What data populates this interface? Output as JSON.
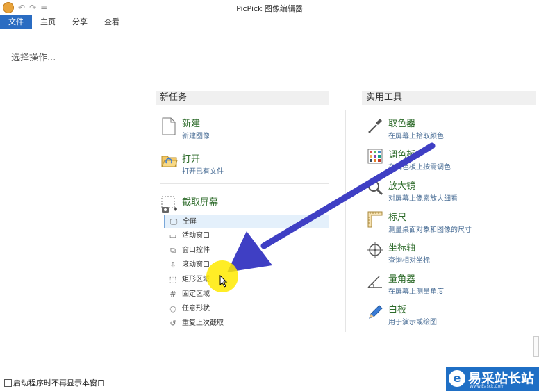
{
  "window": {
    "title": "PicPick 图像编辑器",
    "qat_more": "="
  },
  "tabs": [
    {
      "label": "文件",
      "active": true
    },
    {
      "label": "主页"
    },
    {
      "label": "分享"
    },
    {
      "label": "查看"
    }
  ],
  "prompt": "选择操作...",
  "new_task": {
    "header": "新任务",
    "items": [
      {
        "title": "新建",
        "subtitle": "新建图像",
        "icon": "blank-page-icon"
      },
      {
        "title": "打开",
        "subtitle": "打开已有文件",
        "icon": "open-folder-icon"
      },
      {
        "title": "截取屏幕",
        "subtitle": "",
        "icon": "screen-capture-icon"
      }
    ],
    "capture_options": [
      {
        "label": "全屏",
        "icon": "monitor-icon",
        "selected": true
      },
      {
        "label": "活动窗口",
        "icon": "window-icon"
      },
      {
        "label": "窗口控件",
        "icon": "window-control-icon"
      },
      {
        "label": "滚动窗口",
        "icon": "scroll-window-icon"
      },
      {
        "label": "矩形区域",
        "icon": "rectangle-select-icon"
      },
      {
        "label": "固定区域",
        "icon": "fixed-region-icon"
      },
      {
        "label": "任意形状",
        "icon": "freehand-icon"
      },
      {
        "label": "重复上次截取",
        "icon": "repeat-icon"
      }
    ]
  },
  "tools": {
    "header": "实用工具",
    "items": [
      {
        "title": "取色器",
        "subtitle": "在屏幕上拾取颜色",
        "icon": "eyedropper-icon"
      },
      {
        "title": "调色板",
        "subtitle": "在调色板上按需调色",
        "icon": "palette-icon"
      },
      {
        "title": "放大镜",
        "subtitle": "对屏幕上像素放大细看",
        "icon": "magnifier-icon"
      },
      {
        "title": "标尺",
        "subtitle": "测量桌面对象和图像的尺寸",
        "icon": "ruler-icon"
      },
      {
        "title": "坐标轴",
        "subtitle": "查询相对坐标",
        "icon": "crosshair-icon"
      },
      {
        "title": "量角器",
        "subtitle": "在屏幕上测量角度",
        "icon": "protractor-icon"
      },
      {
        "title": "白板",
        "subtitle": "用于演示或绘图",
        "icon": "pen-icon"
      }
    ]
  },
  "footer": {
    "checkbox_label": "启动程序时不再显示本窗口",
    "checked": false
  },
  "watermark": {
    "text": "易采站长站",
    "sub": "Www.Easck.Com"
  },
  "colors": {
    "tab_active": "#2a6cc2",
    "title_green": "#2d6b2a",
    "subtitle_blue": "#4a6e96",
    "arrow": "#3f3fc4",
    "highlight": "#ffea00"
  }
}
